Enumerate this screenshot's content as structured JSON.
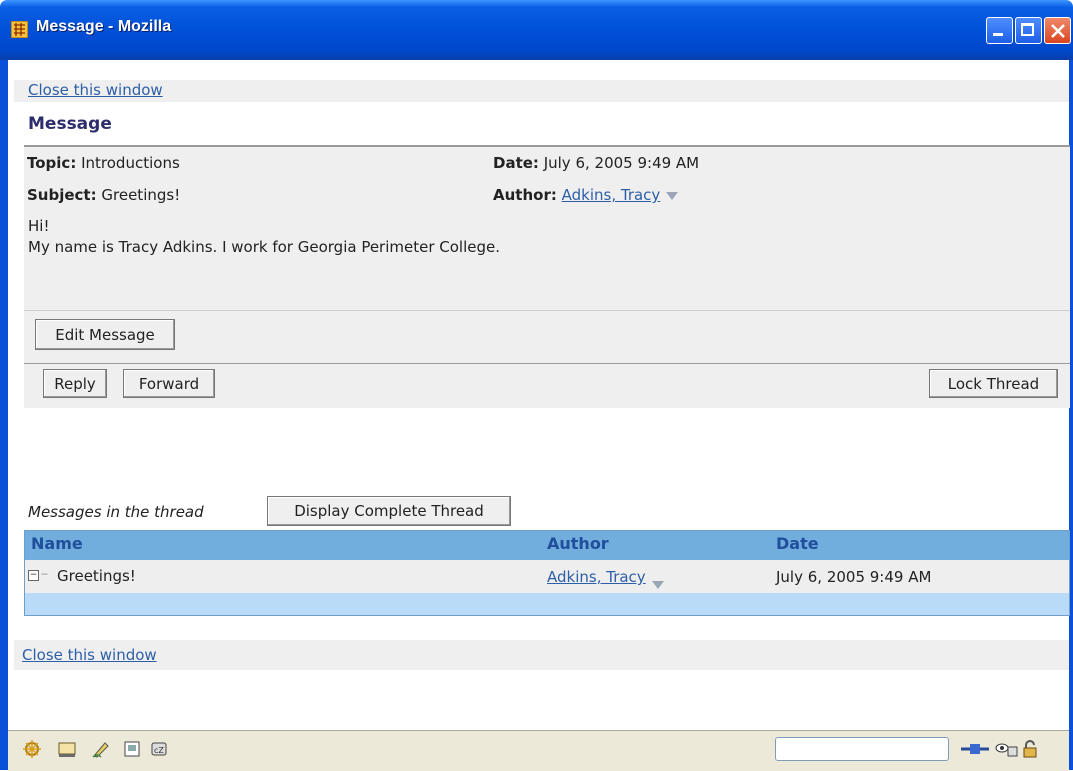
{
  "window": {
    "title": "Message - Mozilla",
    "minimize_label": "_",
    "maximize_label": "□",
    "close_label": "✕"
  },
  "close_link_top": "Close this window",
  "message": {
    "heading": "Message",
    "topic_label": "Topic:",
    "topic_value": "Introductions",
    "date_label": "Date:",
    "date_value": "July 6, 2005 9:49 AM",
    "subject_label": "Subject:",
    "subject_value": "Greetings!",
    "author_label": "Author:",
    "author_value": "Adkins, Tracy",
    "body_line1": "Hi!",
    "body_line2": "My name is Tracy Adkins. I work for Georgia Perimeter College."
  },
  "buttons": {
    "edit_message": "Edit Message",
    "reply": "Reply",
    "forward": "Forward",
    "lock_thread": "Lock Thread",
    "display_complete_thread": "Display Complete Thread"
  },
  "thread": {
    "label": "Messages in the thread",
    "columns": [
      "Name",
      "Author",
      "Date"
    ],
    "rows": [
      {
        "name": "Greetings!",
        "author": "Adkins, Tracy",
        "date": "July 6, 2005 9:49 AM"
      }
    ]
  },
  "close_link_bottom": "Close this window",
  "statusbar": {
    "icons": [
      "navigator-icon",
      "mail-icon",
      "composer-icon",
      "addressbook-icon",
      "chat-icon"
    ],
    "right_icons": [
      "online-icon",
      "security-icon",
      "lock-icon"
    ]
  },
  "colors": {
    "titlebar": "#0050d8",
    "link": "#2d5fa8",
    "table_header": "#71aede",
    "table_body": "#b9dbf8"
  }
}
